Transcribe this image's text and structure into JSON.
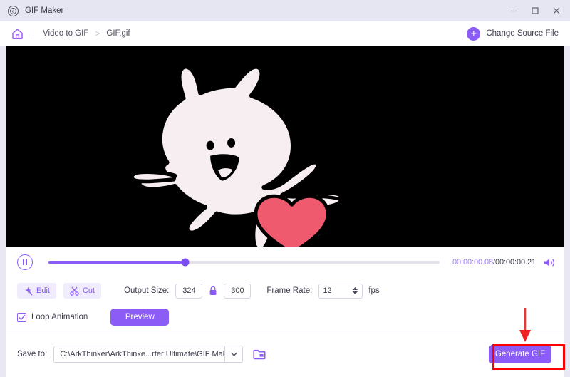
{
  "window": {
    "app_icon": "gif-app-icon",
    "title": "GIF Maker",
    "controls": {
      "minimize": "minimize-icon",
      "maximize": "maximize-icon",
      "close": "close-icon"
    }
  },
  "breadcrumb": {
    "home_icon": "home-icon",
    "items": [
      "Video to GIF",
      "GIF.gif"
    ],
    "separator": ">",
    "change_source": {
      "label": "Change Source File",
      "icon": "plus-circle-icon"
    }
  },
  "video": {
    "background_color": "#000000",
    "character_fill": "#f7eef2",
    "character_outline": "#000000",
    "heart_color": "#ef5a6f"
  },
  "player": {
    "pause_icon": "pause-icon",
    "progress_percent": 35,
    "current_time": "00:00:00.08",
    "separator": "/",
    "total_time": "00:00:00.21",
    "volume_icon": "volume-icon",
    "accent_color": "#8b5cf6"
  },
  "options": {
    "edit": {
      "label": "Edit",
      "icon": "magic-wand-icon"
    },
    "cut": {
      "label": "Cut",
      "icon": "scissors-icon"
    },
    "output_size_label": "Output Size:",
    "output_width": "324",
    "lock_icon": "lock-icon",
    "output_height": "300",
    "frame_rate_label": "Frame Rate:",
    "frame_rate": "12",
    "fps_label": "fps"
  },
  "loop": {
    "checkbox_icon": "checkmark-icon",
    "label": "Loop Animation",
    "preview_label": "Preview"
  },
  "save": {
    "label": "Save to:",
    "path": "C:\\ArkThinker\\ArkThinke...rter Ultimate\\GIF Maker",
    "dropdown_icon": "chevron-down-icon",
    "folder_icon": "folder-open-icon",
    "generate_label": "Generate GIF"
  },
  "annotation": {
    "highlight_color": "#ff0000",
    "arrow_icon": "down-arrow-annotation"
  }
}
